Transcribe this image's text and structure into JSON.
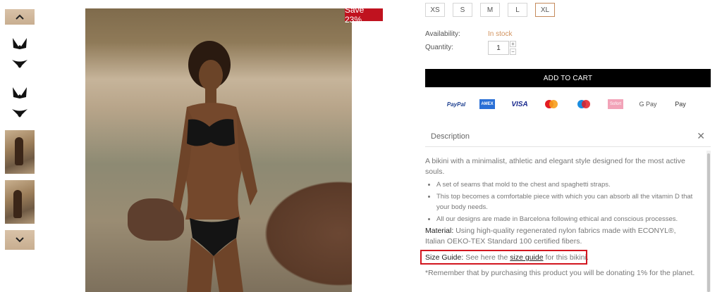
{
  "thumbnails": {
    "up_icon": "chevron-up-icon",
    "down_icon": "chevron-down-icon",
    "items": [
      "bikini-top-black",
      "bikini-bottom-black",
      "bikini-top-black",
      "bikini-bottom-black",
      "photo-model-1",
      "photo-model-2"
    ]
  },
  "badge": {
    "text": "Save 23%",
    "color": "#c0121f"
  },
  "sizes": [
    {
      "label": "XS",
      "selected": false
    },
    {
      "label": "S",
      "selected": false
    },
    {
      "label": "M",
      "selected": false
    },
    {
      "label": "L",
      "selected": false
    },
    {
      "label": "XL",
      "selected": true
    }
  ],
  "availability": {
    "label": "Availability:",
    "value": "In stock"
  },
  "quantity": {
    "label": "Quantity:",
    "value": "1",
    "plus": "+",
    "minus": "−"
  },
  "add_to_cart": "ADD TO CART",
  "payments": [
    "PayPal",
    "AMEX",
    "VISA",
    "Mastercard",
    "Maestro",
    "Sofort",
    "G Pay",
    " Pay"
  ],
  "description": {
    "title": "Description",
    "close_icon": "close-icon",
    "intro": "A bikini with a minimalist, athletic and elegant style designed for the most active souls.",
    "bullets": [
      "A set of seams that mold to the chest and spaghetti straps.",
      "This top becomes a comfortable piece with which you can absorb all the vitamin D that your body needs.",
      "All our designs are made in Barcelona following ethical and conscious processes."
    ],
    "material_label": "Material:",
    "material_text": "Using high-quality regenerated nylon fabrics made with ECONYL®, Italian OEKO-TEX Standard 100 certified fibers.",
    "size_guide_label": "Size Guide:",
    "size_guide_pre": "See here the",
    "size_guide_link": "size guide",
    "size_guide_post": "for this bikini.",
    "note": "*Remember that by purchasing this product you will be donating 1% for the planet."
  },
  "colors": {
    "accent": "#d2935e",
    "cart_bg": "#000000",
    "highlight": "#d2161f"
  }
}
